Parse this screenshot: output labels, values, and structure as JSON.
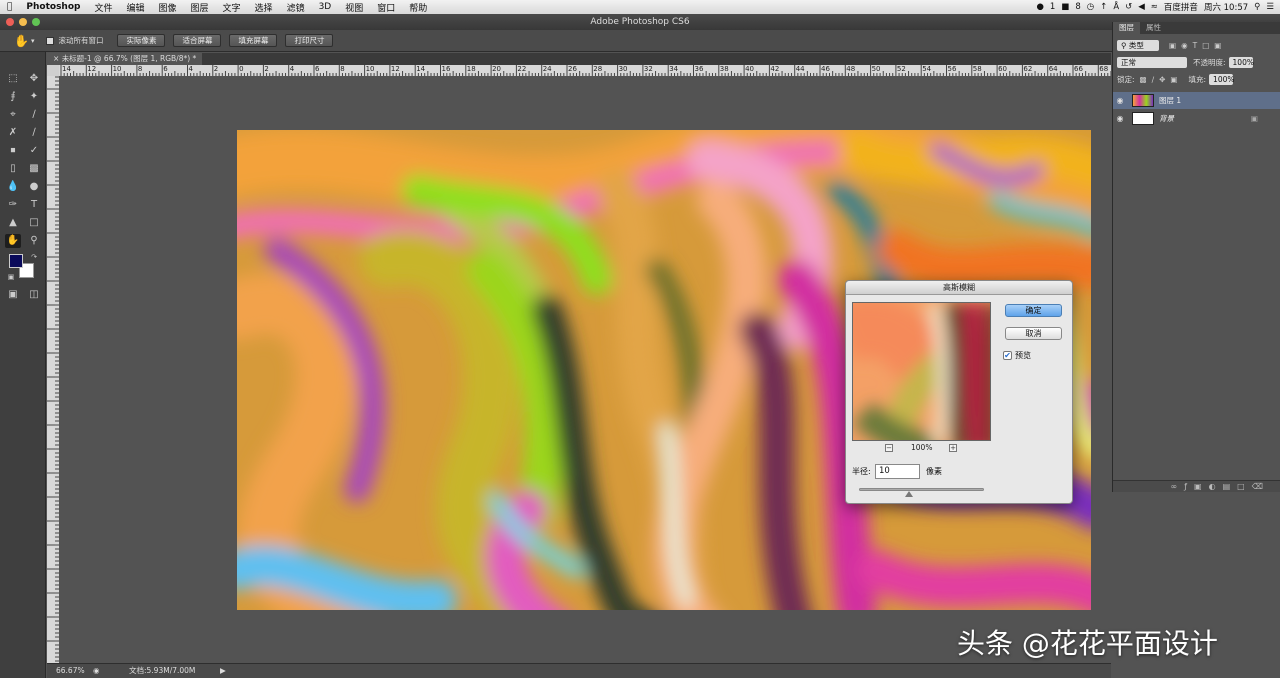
{
  "menubar": {
    "app": "Photoshop",
    "items": [
      "文件",
      "编辑",
      "图像",
      "图层",
      "文字",
      "选择",
      "滤镜",
      "3D",
      "视图",
      "窗口",
      "帮助"
    ],
    "status": {
      "badge1": "1",
      "badge2": "8",
      "input_method": "百度拼音",
      "clock": "周六 10:57"
    }
  },
  "window_title": "Adobe Photoshop CS6",
  "options_bar": {
    "scroll_all": "滚动所有窗口",
    "buttons": [
      "实际像素",
      "适合屏幕",
      "填充屏幕",
      "打印尺寸"
    ]
  },
  "document": {
    "tab_title": "未标题-1 @ 66.7% (图层 1, RGB/8*) *",
    "ruler_labels": [
      "14",
      "12",
      "10",
      "8",
      "6",
      "4",
      "2",
      "0",
      "2",
      "4",
      "6",
      "8",
      "10",
      "12",
      "14",
      "16",
      "18",
      "20",
      "22",
      "24",
      "26",
      "28",
      "30",
      "32",
      "34",
      "36",
      "38",
      "40",
      "42",
      "44",
      "46",
      "48",
      "50",
      "52",
      "54",
      "56",
      "58",
      "60",
      "62",
      "64",
      "66",
      "68"
    ]
  },
  "statusbar": {
    "zoom": "66.67%",
    "doc_size": "文档:5.93M/7.00M"
  },
  "panel": {
    "tabs": [
      "图层",
      "属性"
    ],
    "filter_kind": "类型",
    "blend_mode": "正常",
    "opacity_label": "不透明度:",
    "opacity_value": "100%",
    "lock_label": "锁定:",
    "fill_label": "填充:",
    "fill_value": "100%",
    "layers": [
      {
        "name": "图层 1",
        "selected": true
      },
      {
        "name": "背景",
        "selected": false,
        "locked": true
      }
    ]
  },
  "dialog": {
    "title": "高斯模糊",
    "ok": "确定",
    "cancel": "取消",
    "preview_label": "预览",
    "preview_checked": true,
    "zoom": "100%",
    "radius_label": "半径:",
    "radius_value": "10",
    "radius_unit": "像素",
    "radius_fraction": 0.4
  },
  "watermark": "头条 @花花平面设计",
  "colors": {
    "foreground": "#0a0a5a",
    "background": "#ffffff",
    "primary_button": "#5fa3ea"
  }
}
